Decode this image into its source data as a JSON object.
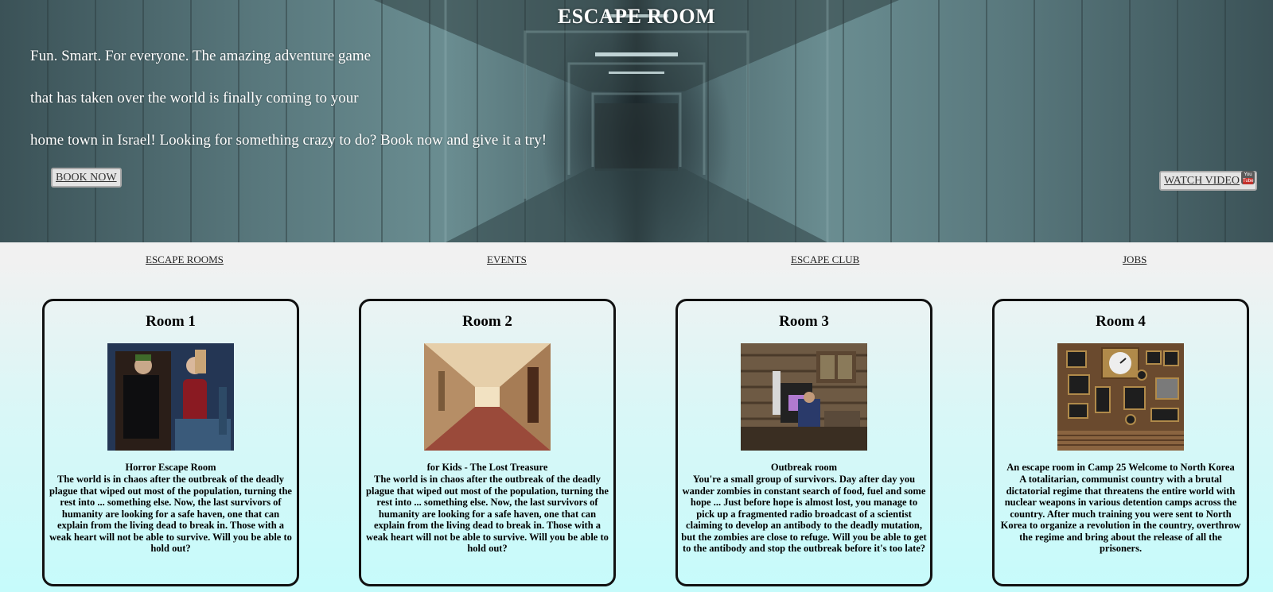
{
  "hero": {
    "title": "ESCAPE ROOM",
    "tagline_lines": [
      "Fun. Smart. For everyone. The amazing adventure game",
      "that has taken over the world is finally coming to your",
      "home town in Israel! Looking for something crazy to do? Book now and give it a try!"
    ],
    "book_button": "BOOK NOW",
    "watch_button": "WATCH VIDEO",
    "youtube_icon": {
      "top": "You",
      "bottom": "Tube"
    }
  },
  "nav": {
    "items": [
      "ESCAPE ROOMS",
      "EVENTS",
      "ESCAPE CLUB",
      "JOBS"
    ]
  },
  "rooms": [
    {
      "title": "Room 1",
      "image": "horror-room-photo",
      "subtitle": "Horror Escape Room",
      "description": "The world is in chaos after the outbreak of the deadly plague that wiped out most of the population, turning the rest into ... something else. Now, the last survivors of humanity are looking for a safe haven, one that can explain from the living dead to break in. Those with a weak heart will not be able to survive. Will you be able to hold out?"
    },
    {
      "title": "Room 2",
      "image": "hallway-photo",
      "subtitle": "for Kids - The Lost Treasure",
      "description": "The world is in chaos after the outbreak of the deadly plague that wiped out most of the population, turning the rest into ... something else. Now, the last survivors of humanity are looking for a safe haven, one that can explain from the living dead to break in. Those with a weak heart will not be able to survive. Will you be able to hold out?"
    },
    {
      "title": "Room 3",
      "image": "cabin-photo",
      "subtitle": "Outbreak room",
      "description": "You're a small group of survivors. Day after day you wander zombies in constant search of food, fuel and some hope ... Just before hope is almost lost, you manage to pick up a fragmented radio broadcast of a scientist claiming to develop an antibody to the deadly mutation, but the zombies are close to refuge. Will you be able to get to the antibody and stop the outbreak before it's too late?"
    },
    {
      "title": "Room 4",
      "image": "frames-wall-photo",
      "subtitle": "An escape room in Camp 25 Welcome to North Korea",
      "description": "A totalitarian, communist country with a brutal dictatorial regime that threatens the entire world with nuclear weapons in various detention camps across the country. After much training you were sent to North Korea to organize a revolution in the country, overthrow the regime and bring about the release of all the prisoners."
    }
  ]
}
